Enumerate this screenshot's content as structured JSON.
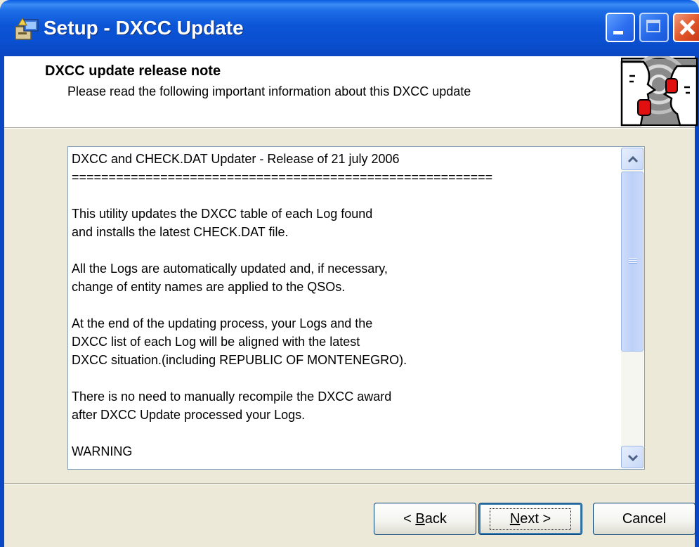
{
  "window": {
    "title": "Setup - DXCC Update"
  },
  "header": {
    "title": "DXCC update release note",
    "subtitle": "Please read the following important information about this DXCC update"
  },
  "memo": {
    "text": "DXCC and CHECK.DAT Updater - Release of 21 july 2006\n=========================================================\n\nThis utility updates the DXCC table of each Log found\nand installs the latest CHECK.DAT file.\n\nAll the Logs are automatically updated and, if necessary,\nchange of entity names are applied to the QSOs.\n\nAt the end of the updating process, your Logs and the\nDXCC list of each Log will be aligned with the latest\nDXCC situation.(including REPUBLIC OF MONTENEGRO).\n\nThere is no need to manually recompile the DXCC award\nafter DXCC Update processed your Logs.\n\nWARNING"
  },
  "buttons": {
    "back": {
      "prefix": "< ",
      "mnemonic": "B",
      "rest": "ack"
    },
    "next": {
      "mnemonic": "N",
      "rest": "ext >"
    },
    "cancel": "Cancel"
  },
  "colors": {
    "titlebar": "#0a55d6",
    "dialog_bg": "#ece9d8",
    "header_bg": "#ffffff",
    "close_button": "#e0552a"
  },
  "icons": {
    "title_icon": "setup-installer-icon",
    "header_image": "wizard-faces-image",
    "scroll_up": "scroll-up-arrow-icon",
    "scroll_down": "scroll-down-arrow-icon"
  }
}
